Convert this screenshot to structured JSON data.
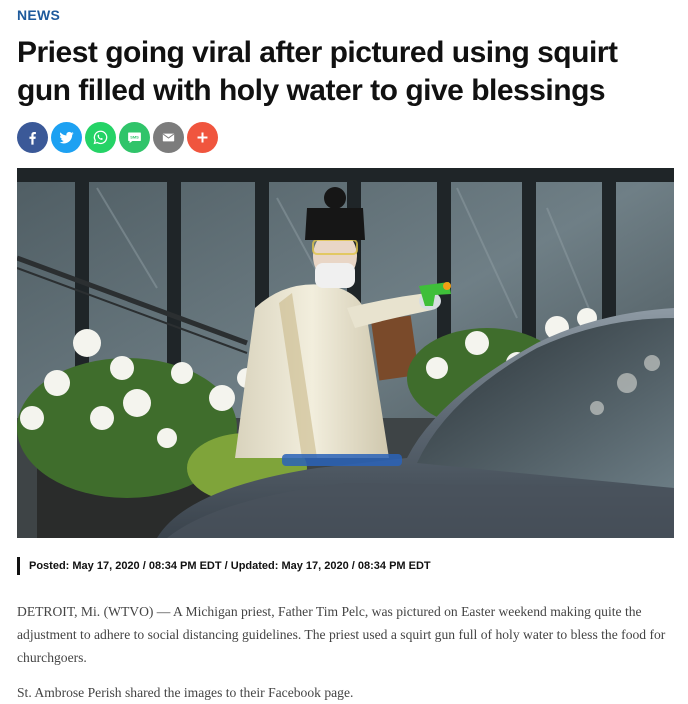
{
  "article": {
    "category": "NEWS",
    "headline": "Priest going viral after pictured using squirt gun filled with holy water to give blessings",
    "byline": "Posted: May 17, 2020 / 08:34 PM EDT / Updated: May 17, 2020 / 08:34 PM EDT",
    "paragraphs": [
      "DETROIT, Mi. (WTVO) — A Michigan priest, Father Tim Pelc, was pictured on Easter weekend making quite the adjustment to adhere to social distancing guidelines. The priest used a squirt gun full of holy water to bless the food for churchgoers.",
      "St. Ambrose Perish shared the images to their Facebook page."
    ]
  },
  "share": [
    {
      "icon": "facebook-icon",
      "color": "#3b5998"
    },
    {
      "icon": "twitter-icon",
      "color": "#1da1f2"
    },
    {
      "icon": "whatsapp-icon",
      "color": "#25d366"
    },
    {
      "icon": "sms-icon",
      "color": "#30c46a",
      "text": "SMS"
    },
    {
      "icon": "email-icon",
      "color": "#7c7c7c"
    },
    {
      "icon": "plus-icon",
      "color": "#f0553e"
    }
  ],
  "colors": {
    "category": "#1e5a9c",
    "headline": "#111111",
    "body": "#444444"
  }
}
